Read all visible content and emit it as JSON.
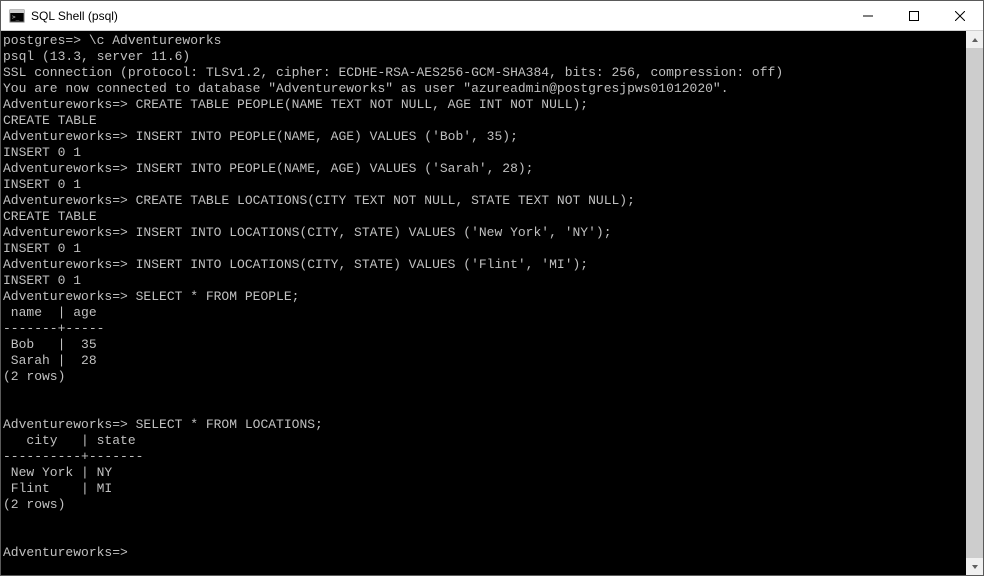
{
  "window": {
    "title": "SQL Shell (psql)"
  },
  "terminal": {
    "lines": [
      "postgres=> \\c Adventureworks",
      "psql (13.3, server 11.6)",
      "SSL connection (protocol: TLSv1.2, cipher: ECDHE-RSA-AES256-GCM-SHA384, bits: 256, compression: off)",
      "You are now connected to database \"Adventureworks\" as user \"azureadmin@postgresjpws01012020\".",
      "Adventureworks=> CREATE TABLE PEOPLE(NAME TEXT NOT NULL, AGE INT NOT NULL);",
      "CREATE TABLE",
      "Adventureworks=> INSERT INTO PEOPLE(NAME, AGE) VALUES ('Bob', 35);",
      "INSERT 0 1",
      "Adventureworks=> INSERT INTO PEOPLE(NAME, AGE) VALUES ('Sarah', 28);",
      "INSERT 0 1",
      "Adventureworks=> CREATE TABLE LOCATIONS(CITY TEXT NOT NULL, STATE TEXT NOT NULL);",
      "CREATE TABLE",
      "Adventureworks=> INSERT INTO LOCATIONS(CITY, STATE) VALUES ('New York', 'NY');",
      "INSERT 0 1",
      "Adventureworks=> INSERT INTO LOCATIONS(CITY, STATE) VALUES ('Flint', 'MI');",
      "INSERT 0 1",
      "Adventureworks=> SELECT * FROM PEOPLE;",
      " name  | age",
      "-------+-----",
      " Bob   |  35",
      " Sarah |  28",
      "(2 rows)",
      "",
      "",
      "Adventureworks=> SELECT * FROM LOCATIONS;",
      "   city   | state",
      "----------+-------",
      " New York | NY",
      " Flint    | MI",
      "(2 rows)",
      "",
      "",
      "Adventureworks=> "
    ]
  }
}
